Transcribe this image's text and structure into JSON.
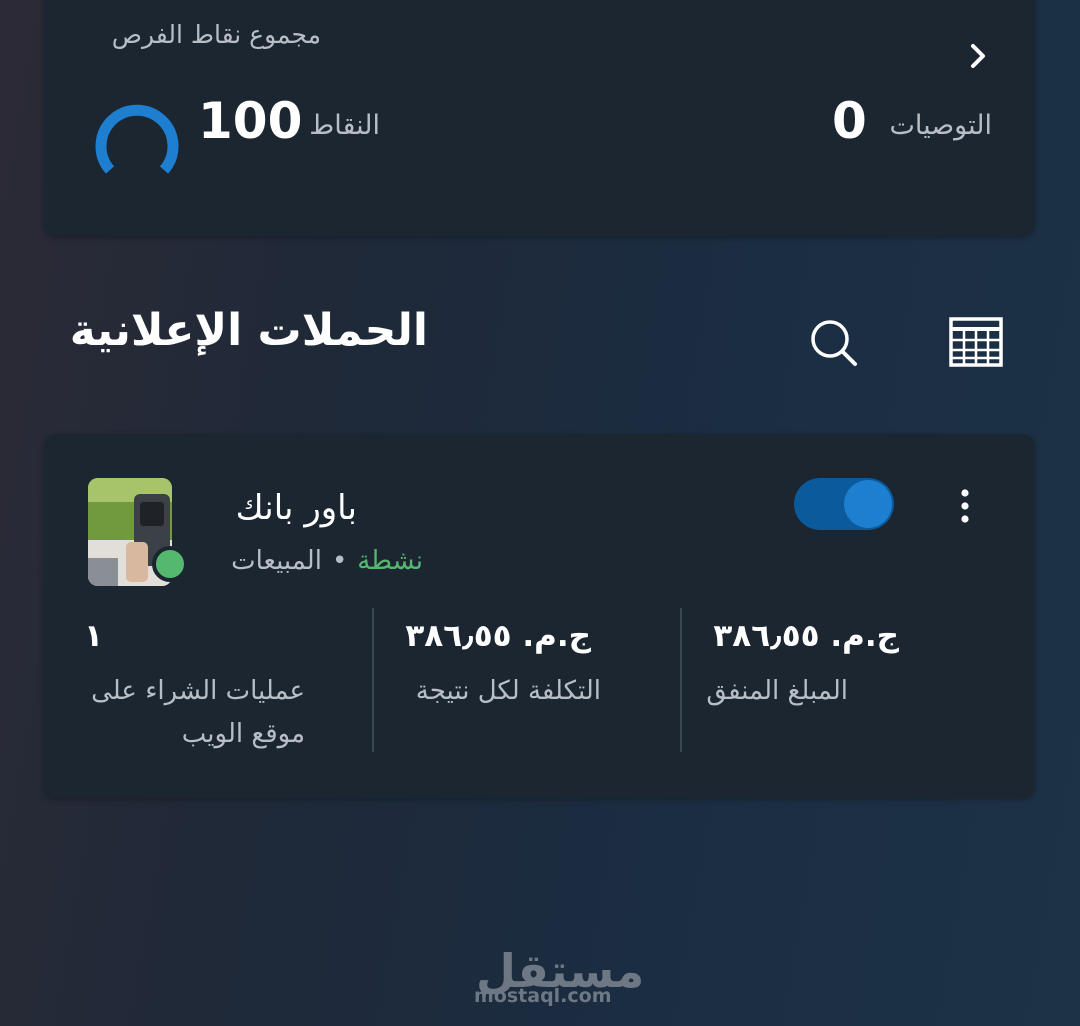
{
  "opportunities": {
    "title": "مجموع نقاط الفرص",
    "points_label": "النقاط",
    "points_value": "100",
    "recommendations_label": "التوصيات",
    "recommendations_value": "0"
  },
  "campaigns": {
    "title": "الحملات الإعلانية",
    "items": [
      {
        "name": "باور بانك",
        "status": "نشطة",
        "separator": "•",
        "objective": "المبيعات",
        "enabled": true,
        "metrics": [
          {
            "value": "ج.م. ٣٨٦٫٥٥",
            "label": "المبلغ المنفق"
          },
          {
            "value": "ج.م. ٣٨٦٫٥٥",
            "label": "التكلفة لكل نتيجة"
          },
          {
            "value": "١",
            "label": "عمليات الشراء على\nموقع الويب"
          }
        ]
      }
    ]
  },
  "icons": {
    "opportunities_chevron": "chevron-right-icon",
    "search": "search-icon",
    "table_view": "table-icon",
    "more": "more-vertical-icon"
  },
  "colors": {
    "active_status": "#55b86f",
    "toggle_on": "#1e7ed0",
    "gauge": "#1e7ed0"
  },
  "watermark": {
    "logo_text": "مستقل",
    "url": "mostaql.com"
  }
}
